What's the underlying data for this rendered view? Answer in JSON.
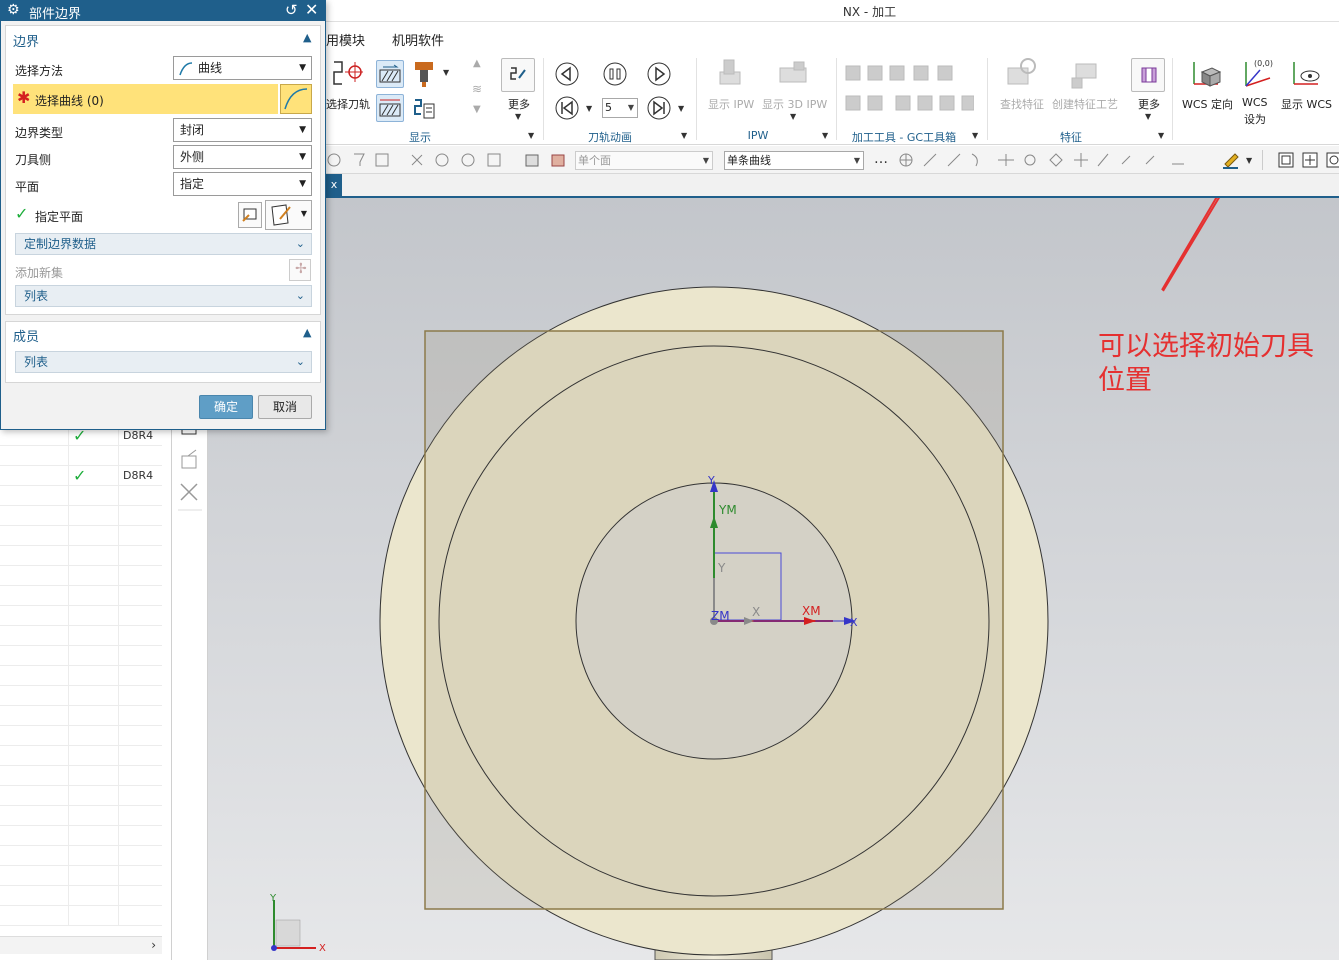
{
  "window": {
    "title": "NX - 加工"
  },
  "menu": {
    "items": [
      {
        "label": "用模块"
      },
      {
        "label": "机明软件"
      }
    ]
  },
  "ribbon": {
    "buttons": {
      "select_toolpath": "选择刀轨",
      "more_display": "更多",
      "show_ipw": "显示 IPW",
      "show_3d_ipw": "显示 3D IPW",
      "find_feature": "查找特征",
      "create_feature_process": "创建特征工艺",
      "more_feature": "更多",
      "wcs_orient": "WCS 定向",
      "wcs_set_line1": "WCS",
      "wcs_set_line2": "设为",
      "show_wcs": "显示 WCS"
    },
    "animation_speed": "5",
    "groups": {
      "display": "显示",
      "toolpath_animation": "刀轨动画",
      "ipw": "IPW",
      "gc_toolkit": "加工工具 - GC工具箱",
      "feature": "特征"
    }
  },
  "selection_bar": {
    "filter_face": "单个面",
    "curve_rule": "单条曲线"
  },
  "tab": {
    "close": "x"
  },
  "dialog": {
    "title": "部件边界",
    "boundary_section": {
      "header": "边界",
      "select_method_label": "选择方法",
      "select_method_value": "曲线",
      "select_curve_label": "选择曲线 (0)",
      "boundary_type_label": "边界类型",
      "boundary_type_value": "封闭",
      "tool_side_label": "刀具侧",
      "tool_side_value": "外侧",
      "plane_label": "平面",
      "plane_value": "指定",
      "specify_plane_label": "指定平面",
      "custom_boundary_data": "定制边界数据",
      "add_new_set": "添加新集",
      "list": "列表"
    },
    "members_section": {
      "header": "成员",
      "list": "列表"
    },
    "ok": "确定",
    "cancel": "取消"
  },
  "navigator": {
    "rows": [
      {
        "checked": true,
        "name": "D8R4"
      },
      {
        "checked": true,
        "name": "D8R4"
      }
    ]
  },
  "viewport": {
    "wcs_labels": {
      "y": "Y",
      "ym": "YM",
      "x": "X",
      "xm": "XM",
      "zm": "ZM",
      "x_axis": "X",
      "y_inner": "Y"
    },
    "triad_labels": {
      "x": "X",
      "y": "Y"
    }
  },
  "annotation": {
    "line1": "可以选择初始刀具",
    "line2": "位置"
  },
  "colors": {
    "accent": "#1f5f8b",
    "selected_row": "#ffe27a",
    "annotation_red": "#e53030",
    "part_fill": "#ece7cf",
    "check_green": "#1fae3c"
  }
}
